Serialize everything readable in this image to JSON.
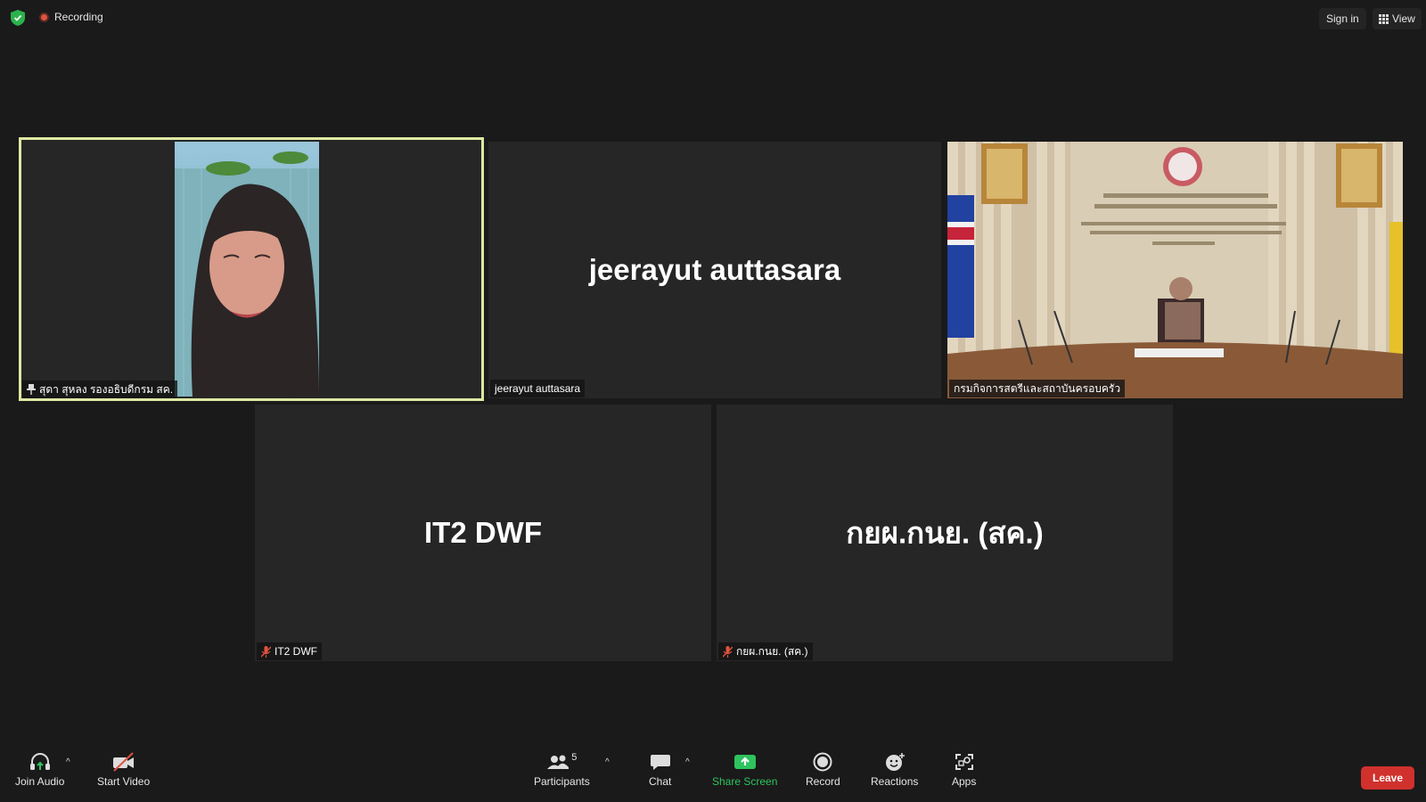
{
  "topbar": {
    "recording_label": "Recording",
    "signin_label": "Sign in",
    "view_label": "View"
  },
  "tiles": {
    "t1": {
      "name": "สุดา สุหลง รองอธิบดีกรม สค."
    },
    "t2": {
      "name": "jeerayut auttasara",
      "display_name": "jeerayut auttasara"
    },
    "t3": {
      "name": "กรมกิจการสตรีและสถาบันครอบครัว"
    },
    "t4": {
      "name": "IT2 DWF",
      "display_name": "IT2 DWF"
    },
    "t5": {
      "name": "กยผ.กนย. (สค.)",
      "display_name": "กยผ.กนย. (สค.)"
    }
  },
  "toolbar": {
    "join_audio": "Join Audio",
    "start_video": "Start Video",
    "participants": "Participants",
    "participants_count": "5",
    "chat": "Chat",
    "share_screen": "Share Screen",
    "record": "Record",
    "reactions": "Reactions",
    "apps": "Apps",
    "leave": "Leave"
  },
  "colors": {
    "active_border": "#dfe8a2",
    "share_green": "#2ec35e",
    "leave_red": "#d0312d",
    "muted_red": "#e0533f"
  }
}
